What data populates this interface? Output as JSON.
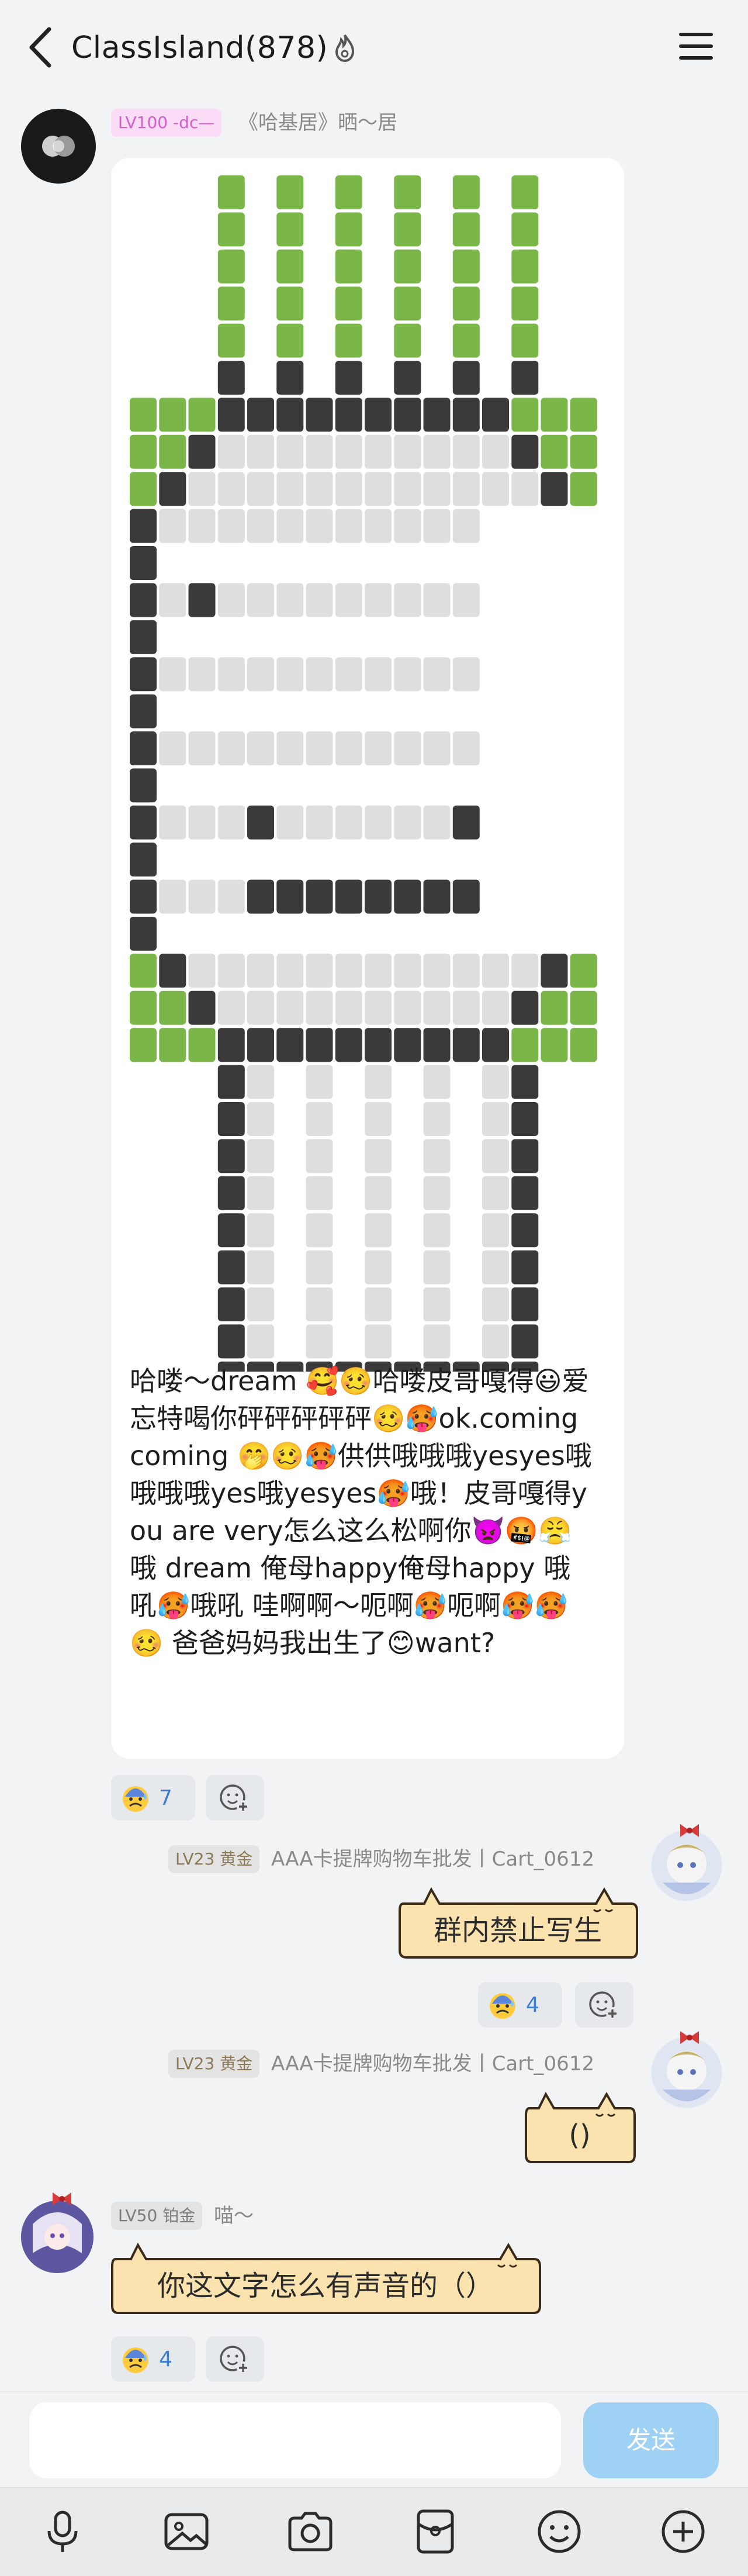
{
  "header": {
    "title": "ClassIsland(878)",
    "title_icon": "fire-icon",
    "back_icon": "chevron-left-icon",
    "menu_icon": "hamburger-menu-icon"
  },
  "colors": {
    "green": "#7ab648",
    "dark": "#3a3a3a",
    "light": "#dedede",
    "send": "#9fd1f5",
    "link": "#3b7bd6",
    "parchment": "#fbe3b0"
  },
  "messages": [
    {
      "badge": "LV100 -dc—",
      "sender": "《哈基居》晒～居",
      "text": "哈喽～dream 🥰🥴哈喽皮哥嘎得😃爱忘特喝你砰砰砰砰砰🥴🥵ok.coming coming 🤭🥴🥵供供哦哦哦yesyes哦哦哦哦yes哦yesyes🥵哦！皮哥嘎得you are very怎么这么松啊你👿🤬😤 哦 dream 俺母happy俺母happy  哦吼🥵哦吼  哇啊啊～呃啊🥵呃啊🥵🥵🥴     爸爸妈妈我出生了😊want?",
      "reaction_count": "7"
    },
    {
      "badge": "LV23 黄金",
      "sender": "AAA卡提牌购物车批发丨Cart_0612",
      "text": "群内禁止写生",
      "reaction_count": "4"
    },
    {
      "badge": "LV23 黄金",
      "sender": "AAA卡提牌购物车批发丨Cart_0612",
      "text": "()"
    },
    {
      "badge": "LV50 铂金",
      "sender": "喵～",
      "text": "你这文字怎么有声音的（）",
      "reaction_count": "4"
    }
  ],
  "composer": {
    "placeholder": "",
    "send_label": "发送"
  },
  "toolbar": {
    "icons": [
      "microphone-icon",
      "image-icon",
      "camera-icon",
      "red-packet-icon",
      "emoji-icon",
      "plus-icon"
    ]
  }
}
